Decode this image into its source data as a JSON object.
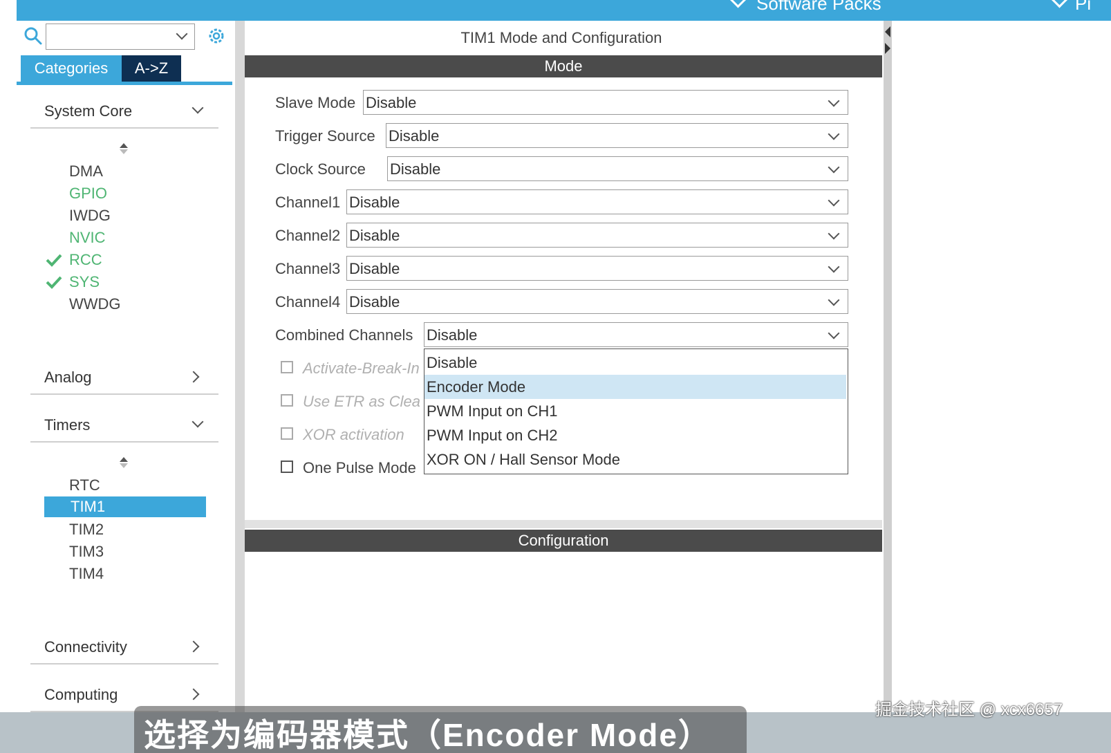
{
  "topbar": {
    "software_packs": "Software Packs",
    "pinout_partial": "Pi"
  },
  "left": {
    "search": {
      "value": "",
      "placeholder": ""
    },
    "tabs": {
      "categories": "Categories",
      "az": "A->Z"
    },
    "sections": {
      "system_core": "System Core",
      "analog": "Analog",
      "timers": "Timers",
      "connectivity": "Connectivity",
      "computing": "Computing"
    },
    "system_core_items": {
      "dma": "DMA",
      "gpio": "GPIO",
      "iwdg": "IWDG",
      "nvic": "NVIC",
      "rcc": "RCC",
      "sys": "SYS",
      "wwdg": "WWDG"
    },
    "timer_items": {
      "rtc": "RTC",
      "tim1": "TIM1",
      "tim2": "TIM2",
      "tim3": "TIM3",
      "tim4": "TIM4"
    }
  },
  "center": {
    "title": "TIM1 Mode and Configuration",
    "mode_bar": "Mode",
    "config_bar": "Configuration",
    "fields": {
      "slave_mode": {
        "label": "Slave Mode",
        "value": "Disable"
      },
      "trigger_source": {
        "label": "Trigger Source",
        "value": "Disable"
      },
      "clock_source": {
        "label": "Clock Source",
        "value": "Disable"
      },
      "channel1": {
        "label": "Channel1",
        "value": "Disable"
      },
      "channel2": {
        "label": "Channel2",
        "value": "Disable"
      },
      "channel3": {
        "label": "Channel3",
        "value": "Disable"
      },
      "channel4": {
        "label": "Channel4",
        "value": "Disable"
      },
      "combined_channels": {
        "label": "Combined Channels",
        "value": "Disable"
      }
    },
    "checkboxes": {
      "activate_break": "Activate-Break-In",
      "use_etr": "Use ETR as Clea",
      "xor_activation": "XOR activation",
      "one_pulse": "One Pulse Mode"
    },
    "dropdown_options": {
      "o1": "Disable",
      "o2": "Encoder Mode",
      "o3": "PWM Input on CH1",
      "o4": "PWM Input on CH2",
      "o5": "XOR ON / Hall Sensor Mode"
    },
    "highlighted_option": "Encoder Mode"
  },
  "overlay": {
    "subtitle": "选择为编码器模式（Encoder Mode）",
    "watermark": "掘金技术社区 @ xcx6657"
  },
  "colors": {
    "accent": "#3ca7da",
    "tab_dark": "#0e2f52",
    "bar": "#4b4b4b",
    "green": "#4fb573",
    "highlight": "#cfe6f4"
  }
}
